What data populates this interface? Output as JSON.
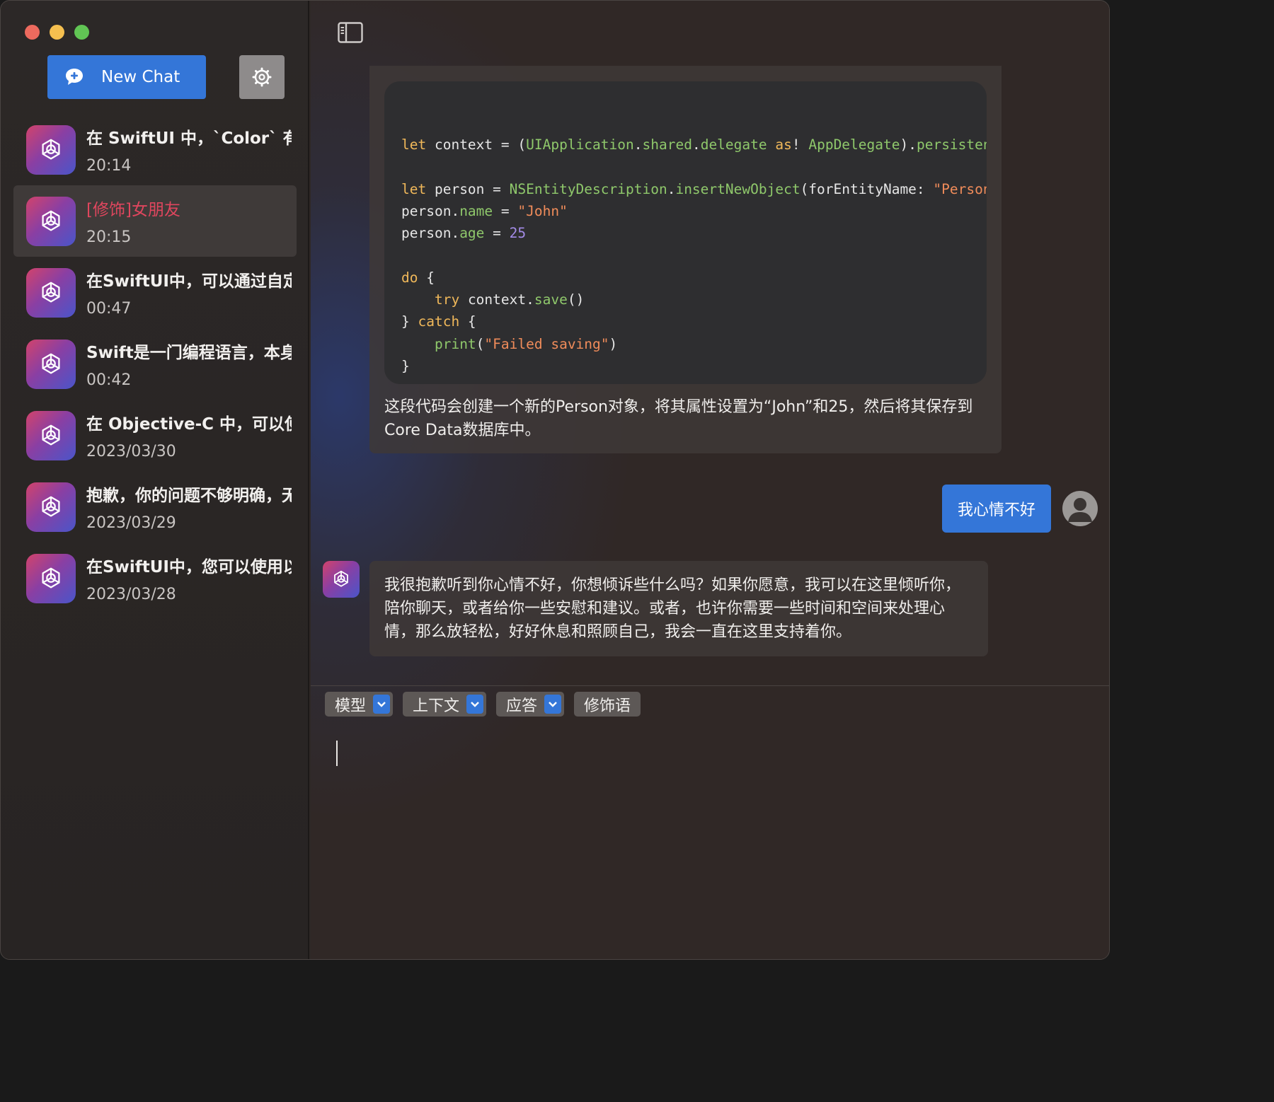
{
  "sidebar": {
    "new_chat_label": "New Chat",
    "settings_icon": "gear-icon",
    "items": [
      {
        "title": "在 SwiftUI 中，`Color` 有一",
        "time": "20:14",
        "selected": false
      },
      {
        "title": "[修饰]女朋友",
        "time": "20:15",
        "selected": true
      },
      {
        "title": "在SwiftUI中，可以通过自定",
        "time": "00:47",
        "selected": false
      },
      {
        "title": "Swift是一门编程语言，本身",
        "time": "00:42",
        "selected": false
      },
      {
        "title": "在 Objective-C 中，可以使用",
        "time": "2023/03/30",
        "selected": false
      },
      {
        "title": "抱歉，你的问题不够明确，无",
        "time": "2023/03/29",
        "selected": false
      },
      {
        "title": "在SwiftUI中，您可以使用以",
        "time": "2023/03/28",
        "selected": false
      }
    ]
  },
  "messages": {
    "ai_1": {
      "code_lines": [
        [
          {
            "t": "let",
            "c": "kw"
          },
          {
            "t": " context = (",
            "c": ""
          },
          {
            "t": "UIApplication",
            "c": "ty"
          },
          {
            "t": ".",
            "c": ""
          },
          {
            "t": "shared",
            "c": "fn"
          },
          {
            "t": ".",
            "c": ""
          },
          {
            "t": "delegate",
            "c": "fn"
          },
          {
            "t": " ",
            "c": ""
          },
          {
            "t": "as",
            "c": "kw"
          },
          {
            "t": "! ",
            "c": ""
          },
          {
            "t": "AppDelegate",
            "c": "ty"
          },
          {
            "t": ").",
            "c": ""
          },
          {
            "t": "persistentContainer",
            "c": "fn"
          }
        ],
        [],
        [
          {
            "t": "let",
            "c": "kw"
          },
          {
            "t": " person = ",
            "c": ""
          },
          {
            "t": "NSEntityDescription",
            "c": "ty"
          },
          {
            "t": ".",
            "c": ""
          },
          {
            "t": "insertNewObject",
            "c": "fn"
          },
          {
            "t": "(forEntityName: ",
            "c": ""
          },
          {
            "t": "\"Person\"",
            "c": "str"
          }
        ],
        [
          {
            "t": "person.",
            "c": ""
          },
          {
            "t": "name",
            "c": "fn"
          },
          {
            "t": " = ",
            "c": ""
          },
          {
            "t": "\"John\"",
            "c": "str"
          }
        ],
        [
          {
            "t": "person.",
            "c": ""
          },
          {
            "t": "age",
            "c": "fn"
          },
          {
            "t": " = ",
            "c": ""
          },
          {
            "t": "25",
            "c": "num"
          }
        ],
        [],
        [
          {
            "t": "do",
            "c": "kw"
          },
          {
            "t": " {",
            "c": ""
          }
        ],
        [
          {
            "t": "    ",
            "c": ""
          },
          {
            "t": "try",
            "c": "kw"
          },
          {
            "t": " context.",
            "c": ""
          },
          {
            "t": "save",
            "c": "fn"
          },
          {
            "t": "()",
            "c": ""
          }
        ],
        [
          {
            "t": "} ",
            "c": ""
          },
          {
            "t": "catch",
            "c": "kw"
          },
          {
            "t": " {",
            "c": ""
          }
        ],
        [
          {
            "t": "    ",
            "c": ""
          },
          {
            "t": "print",
            "c": "fn"
          },
          {
            "t": "(",
            "c": ""
          },
          {
            "t": "\"Failed saving\"",
            "c": "str"
          },
          {
            "t": ")",
            "c": ""
          }
        ],
        [
          {
            "t": "}",
            "c": ""
          }
        ]
      ],
      "description": "这段代码会创建一个新的Person对象，将其属性设置为“John”和25，然后将其保存到Core Data数据库中。"
    },
    "user_1": "我心情不好",
    "ai_2": "我很抱歉听到你心情不好，你想倾诉些什么吗？如果你愿意，我可以在这里倾听你，陪你聊天，或者给你一些安慰和建议。或者，也许你需要一些时间和空间来处理心情，那么放轻松，好好休息和照顾自己，我会一直在这里支持着你。"
  },
  "toolbar": {
    "model_label": "模型",
    "context_label": "上下文",
    "response_label": "应答",
    "modifier_label": "修饰语"
  },
  "composer": {
    "value": ""
  }
}
